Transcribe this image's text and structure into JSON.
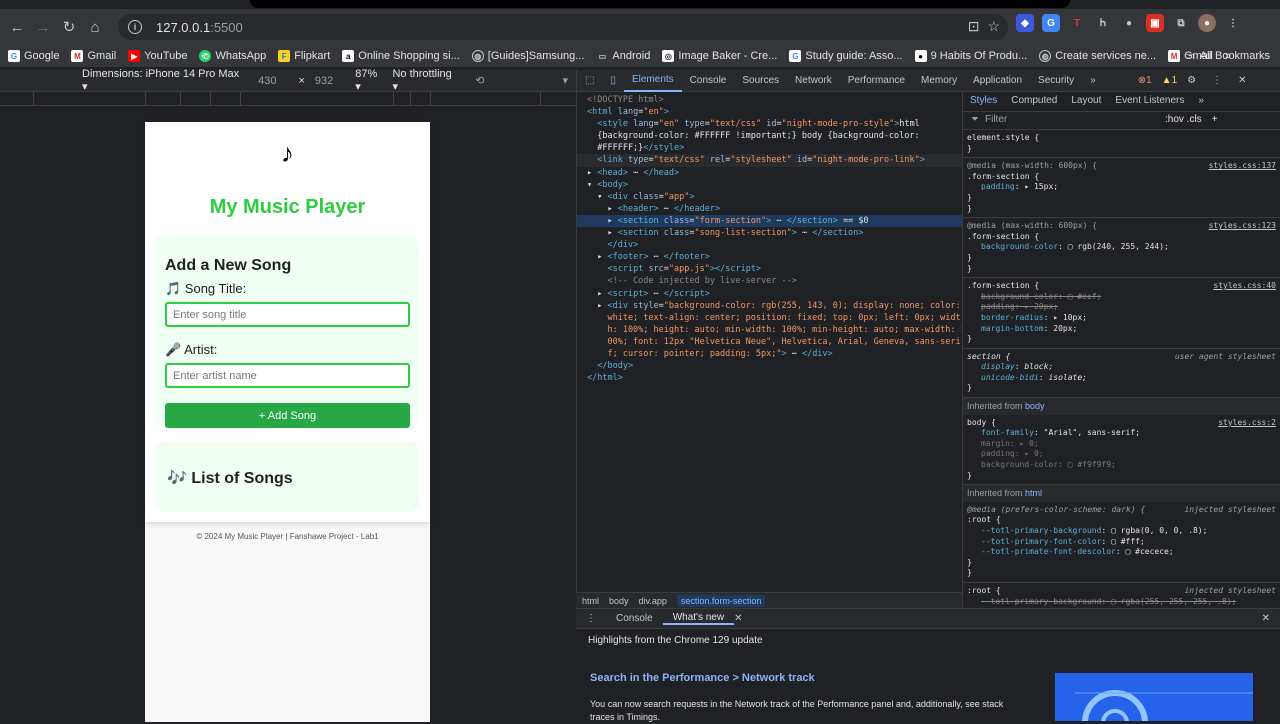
{
  "browser": {
    "url_host": "127.0.0.1",
    "url_port": ":5500",
    "bookmarks": [
      "Google",
      "Gmail",
      "YouTube",
      "WhatsApp",
      "Flipkart",
      "Online Shopping si...",
      "[Guides]Samsung...",
      "Android",
      "Image Baker - Cre...",
      "Study guide: Asso...",
      "9 Habits Of Produ...",
      "Create services ne...",
      "Gmail"
    ],
    "all_bookmarks": "All Bookmarks",
    "more": "»"
  },
  "device_toolbar": {
    "dimensions": "Dimensions: iPhone 14 Pro Max ▾",
    "width": "430",
    "times": "×",
    "height": "932",
    "zoom": "87% ▾",
    "throttle": "No throttling ▾"
  },
  "page": {
    "note_icon": "♪",
    "title": "My Music Player",
    "form_heading": "Add a New Song",
    "song_title_label": "🎵 Song Title:",
    "song_title_placeholder": "Enter song title",
    "artist_label": "🎤 Artist:",
    "artist_placeholder": "Enter artist name",
    "add_button": "+ Add Song",
    "list_heading": "🎶 List of Songs",
    "footer": "© 2024 My Music Player | Fanshawe Project - Lab1"
  },
  "devtools": {
    "tabs": [
      "Elements",
      "Console",
      "Sources",
      "Network",
      "Performance",
      "Memory",
      "Application",
      "Security",
      "»"
    ],
    "errors": "1",
    "warnings": "1",
    "breadcrumbs": [
      "html",
      "body",
      "div.app",
      "section.form-section"
    ],
    "styles_tabs": [
      "Styles",
      "Computed",
      "Layout",
      "Event Listeners",
      "»"
    ],
    "filter_placeholder": "Filter",
    "filter_tools": ":hov .cls"
  },
  "drawer": {
    "tabs": [
      "Console",
      "What's new"
    ],
    "highlights": "Highlights from the Chrome 129 update",
    "article_title": "Search in the Performance > Network track",
    "article_text": "You can now search requests in the Network track of the Performance panel and, additionally, see stack traces in Timings."
  }
}
